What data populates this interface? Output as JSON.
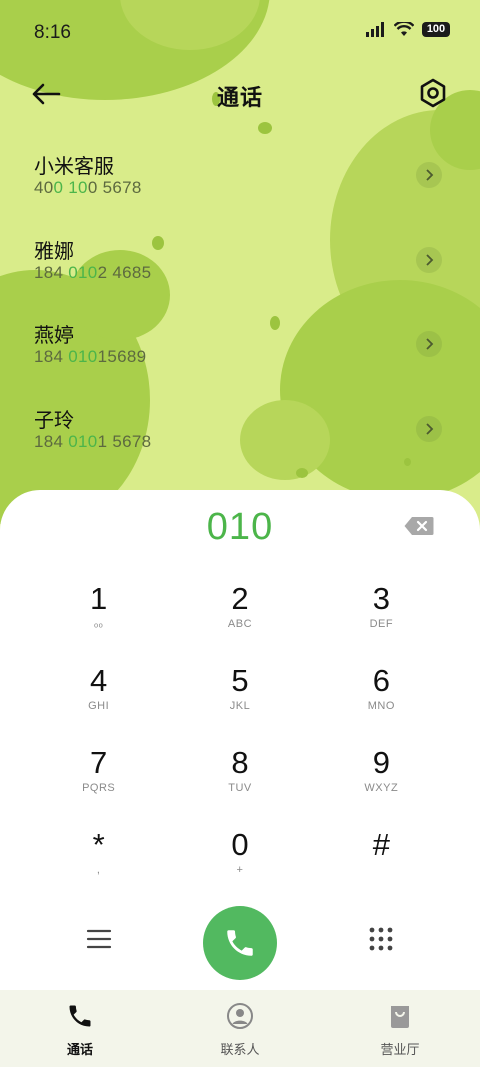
{
  "status_bar": {
    "time": "8:16",
    "battery": "100"
  },
  "header": {
    "title": "通话"
  },
  "contacts": [
    {
      "name": "小米客服",
      "number_parts": [
        "40",
        "0 10",
        "0 5678"
      ]
    },
    {
      "name": "雅娜",
      "number_parts": [
        "184 ",
        "010",
        "2 4685"
      ]
    },
    {
      "name": "燕婷",
      "number_parts": [
        "184 ",
        "010",
        "15689"
      ]
    },
    {
      "name": "子玲",
      "number_parts": [
        "184 ",
        "010",
        "1 5678"
      ]
    }
  ],
  "dialer": {
    "typed_number": "010",
    "keys": [
      {
        "digit": "1",
        "letters": "ₒₒ"
      },
      {
        "digit": "2",
        "letters": "ABC"
      },
      {
        "digit": "3",
        "letters": "DEF"
      },
      {
        "digit": "4",
        "letters": "GHI"
      },
      {
        "digit": "5",
        "letters": "JKL"
      },
      {
        "digit": "6",
        "letters": "MNO"
      },
      {
        "digit": "7",
        "letters": "PQRS"
      },
      {
        "digit": "8",
        "letters": "TUV"
      },
      {
        "digit": "9",
        "letters": "WXYZ"
      },
      {
        "digit": "*",
        "letters": ","
      },
      {
        "digit": "0",
        "letters": "+"
      },
      {
        "digit": "#",
        "letters": ""
      }
    ]
  },
  "nav": [
    {
      "label": "通话",
      "icon": "phone-icon",
      "active": true
    },
    {
      "label": "联系人",
      "icon": "person-icon",
      "active": false
    },
    {
      "label": "营业厅",
      "icon": "bag-icon",
      "active": false
    }
  ],
  "colors": {
    "accent": "#4cb54a",
    "call_button": "#52b960",
    "background": "#d9ec8a"
  }
}
